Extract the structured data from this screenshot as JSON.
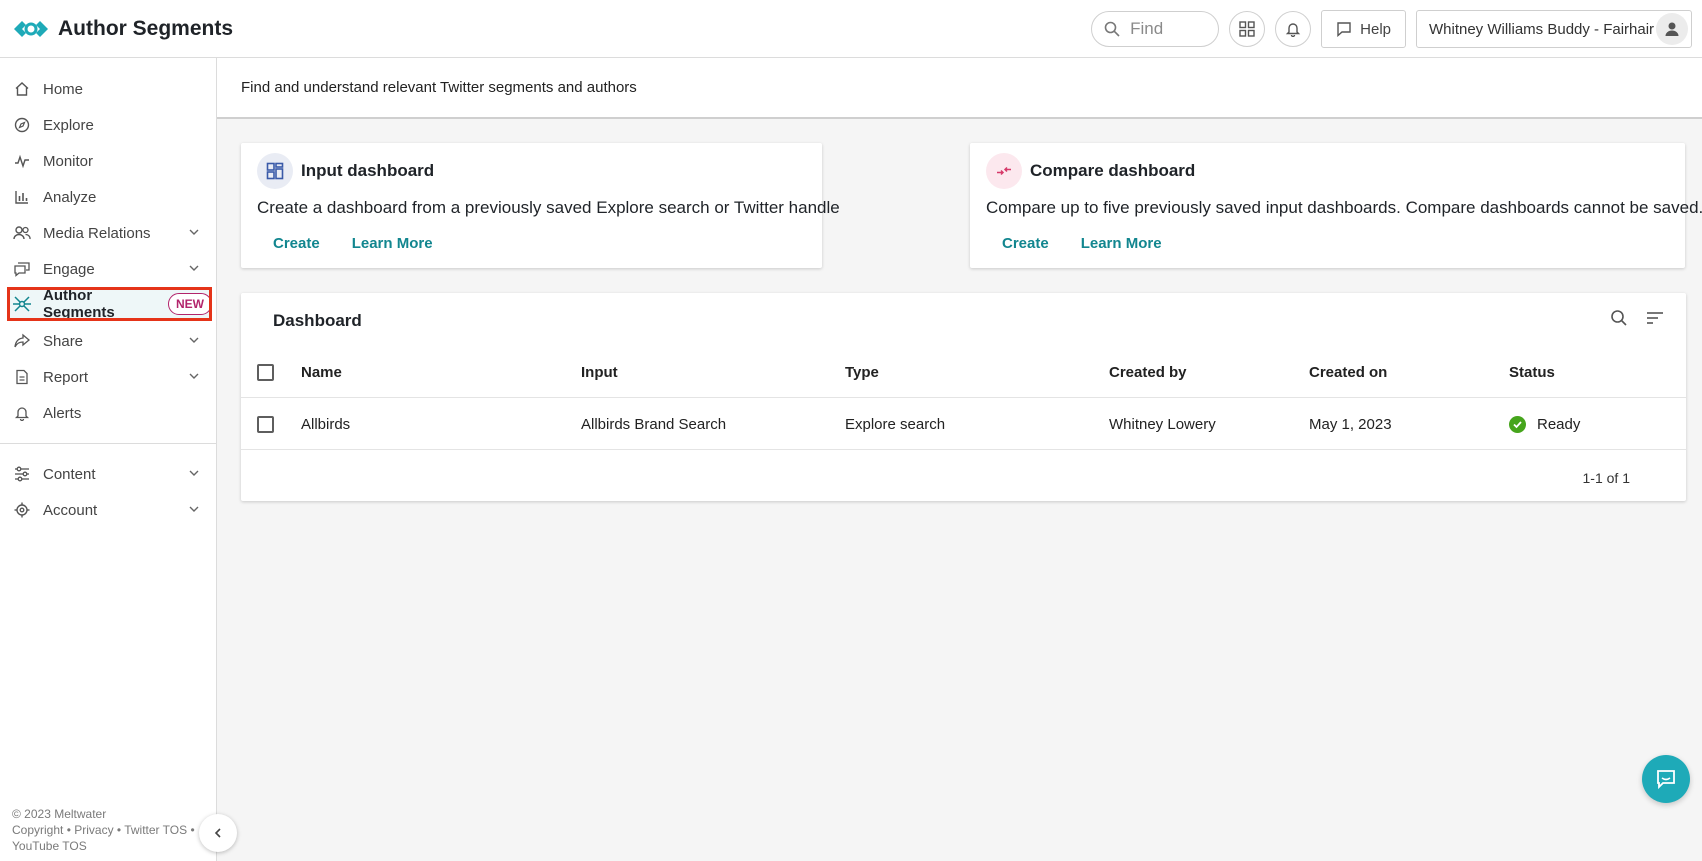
{
  "header": {
    "app_title": "Author Segments",
    "find_placeholder": "Find",
    "help_label": "Help",
    "user_label": "Whitney Williams Buddy - Fairhair"
  },
  "sidebar": {
    "items": [
      {
        "label": "Home",
        "icon": "home-icon"
      },
      {
        "label": "Explore",
        "icon": "compass-icon"
      },
      {
        "label": "Monitor",
        "icon": "pulse-icon"
      },
      {
        "label": "Analyze",
        "icon": "bar-chart-icon"
      },
      {
        "label": "Media Relations",
        "icon": "people-icon",
        "expandable": true
      },
      {
        "label": "Engage",
        "icon": "chat-icon",
        "expandable": true
      },
      {
        "label": "Author Segments",
        "icon": "network-icon",
        "active": true,
        "badge": "NEW"
      },
      {
        "label": "Share",
        "icon": "share-icon",
        "expandable": true
      },
      {
        "label": "Report",
        "icon": "document-icon",
        "expandable": true
      },
      {
        "label": "Alerts",
        "icon": "bell-icon"
      },
      {
        "label": "Content",
        "icon": "sliders-icon",
        "expandable": true
      },
      {
        "label": "Account",
        "icon": "gear-icon",
        "expandable": true
      }
    ],
    "footer": {
      "copyright": "© 2023 Meltwater",
      "links_line": "Copyright • Privacy • Twitter TOS •",
      "links_line2": "YouTube TOS"
    }
  },
  "subheader": {
    "text": "Find and understand relevant Twitter segments and authors"
  },
  "input_card": {
    "title": "Input dashboard",
    "description": "Create a dashboard from a previously saved Explore search or Twitter handle",
    "create": "Create",
    "learn_more": "Learn More"
  },
  "compare_card": {
    "title": "Compare dashboard",
    "description": "Compare up to five previously saved input dashboards. Compare dashboards cannot be saved.",
    "create": "Create",
    "learn_more": "Learn More"
  },
  "dashboard_table": {
    "title": "Dashboard",
    "columns": [
      "Name",
      "Input",
      "Type",
      "Created by",
      "Created on",
      "Status"
    ],
    "rows": [
      {
        "name": "Allbirds",
        "input": "Allbirds Brand Search",
        "type": "Explore search",
        "created_by": "Whitney Lowery",
        "created_on": "May 1, 2023",
        "status": "Ready"
      }
    ],
    "pagination": "1-1 of 1"
  },
  "colors": {
    "accent": "#12868f",
    "highlight": "#e53419",
    "badge": "#b2246b",
    "status_ready": "#46a51c",
    "chat": "#1eaab8"
  }
}
